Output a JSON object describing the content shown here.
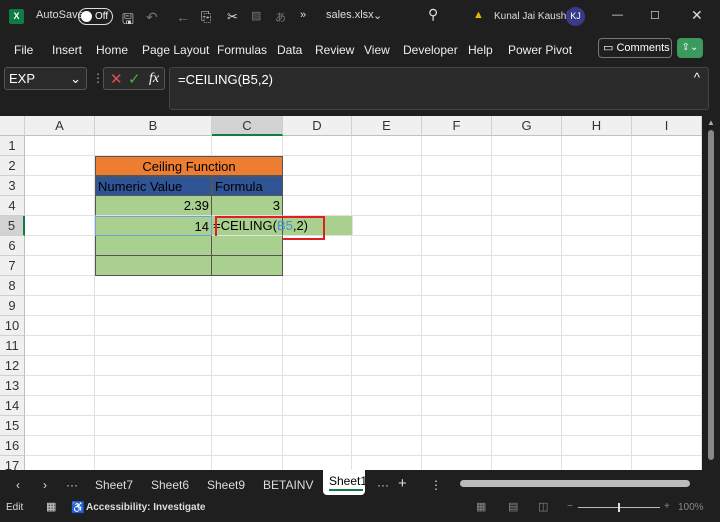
{
  "titlebar": {
    "autosave_label": "AutoSave",
    "autosave_state": "Off",
    "filename": "sales.xlsx",
    "user_name": "Kunal Jai Kaushik",
    "user_initials": "KJ"
  },
  "ribbon": {
    "tabs": [
      "File",
      "Insert",
      "Home",
      "Page Layout",
      "Formulas",
      "Data",
      "Review",
      "View",
      "Developer",
      "Help",
      "Power Pivot"
    ],
    "comments_label": "Comments"
  },
  "formula_bar": {
    "name_box": "EXP",
    "formula": "=CEILING(B5,2)",
    "fx": "fx"
  },
  "columns": [
    "A",
    "B",
    "C",
    "D",
    "E",
    "F",
    "G",
    "H",
    "I"
  ],
  "rows": [
    "1",
    "2",
    "3",
    "4",
    "5",
    "6",
    "7",
    "8",
    "9",
    "10",
    "11",
    "12",
    "13",
    "14",
    "15",
    "16",
    "17"
  ],
  "cells": {
    "title": "Ceiling Function",
    "header_b": "Numeric Value",
    "header_c": "Formula",
    "b4": "2.39",
    "c4": "3",
    "b5": "14",
    "c5_prefix": "=CEILING(",
    "c5_ref": "B5",
    "c5_suffix": ",2)"
  },
  "colors": {
    "orange": "#ed7d31",
    "blue": "#2f5597",
    "green": "#a9d08e",
    "edit_red": "#e02020",
    "ref_blue": "#4a90d9",
    "accent": "#107c41"
  },
  "sheets": {
    "tabs": [
      "Sheet7",
      "Sheet6",
      "Sheet9",
      "BETAINV",
      "Sheet1"
    ],
    "active": "Sheet1"
  },
  "status": {
    "mode": "Edit",
    "accessibility": "Accessibility: Investigate",
    "zoom": "100%"
  }
}
